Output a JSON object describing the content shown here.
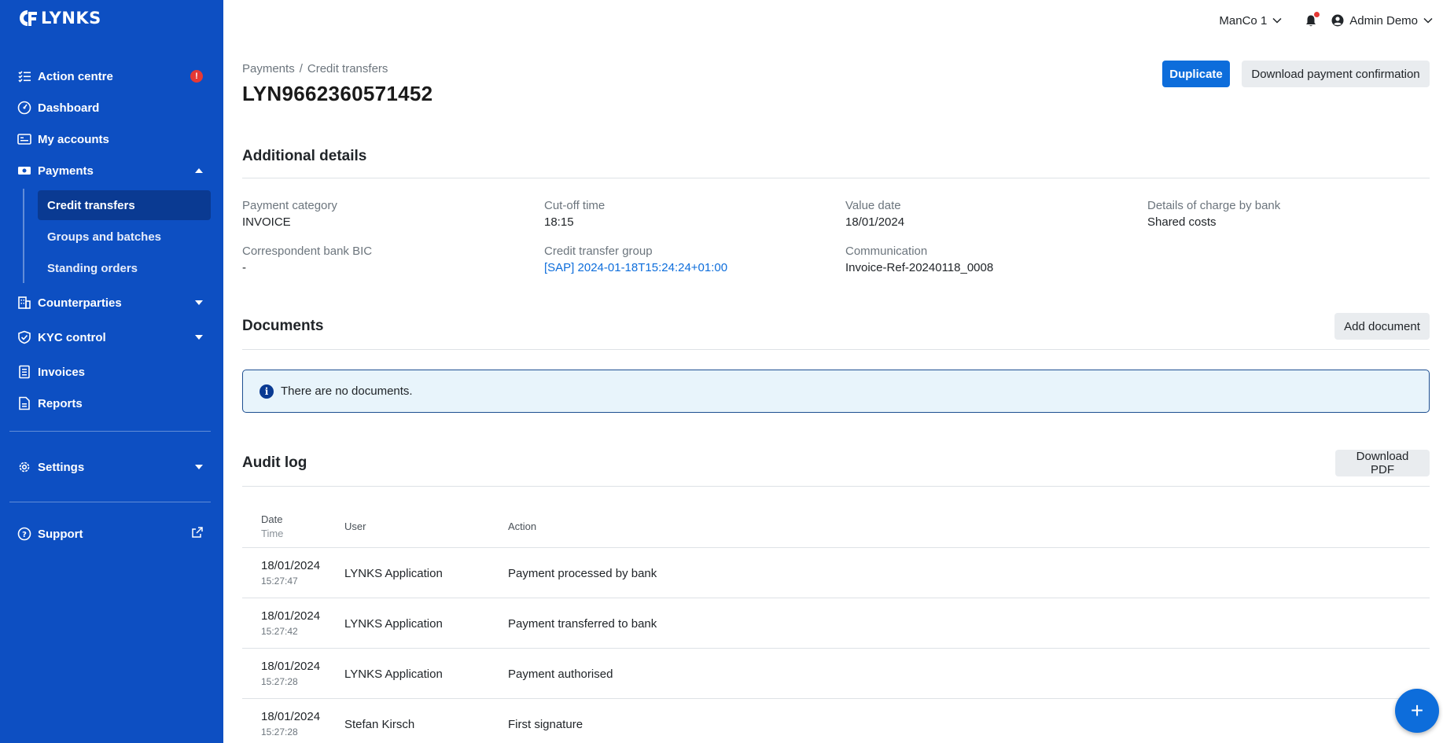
{
  "brand": {
    "name": "LYNKS"
  },
  "colors": {
    "sidebar": "#0d4fc2",
    "primary": "#0d6ddb",
    "alert_bg": "#e8f4fb",
    "badge": "#e53935"
  },
  "sidebar": {
    "items": [
      {
        "label": "Action centre",
        "icon": "list-check-icon",
        "badge": "!"
      },
      {
        "label": "Dashboard",
        "icon": "gauge-icon"
      },
      {
        "label": "My accounts",
        "icon": "accounts-icon"
      },
      {
        "label": "Payments",
        "icon": "payments-icon",
        "expanded": true
      },
      {
        "label": "Counterparties",
        "icon": "building-icon"
      },
      {
        "label": "KYC control",
        "icon": "shield-check-icon"
      },
      {
        "label": "Invoices",
        "icon": "invoice-icon"
      },
      {
        "label": "Reports",
        "icon": "report-icon"
      },
      {
        "label": "Settings",
        "icon": "gear-icon"
      },
      {
        "label": "Support",
        "icon": "help-circle-icon"
      }
    ],
    "payments_sub": [
      {
        "label": "Credit transfers",
        "active": true
      },
      {
        "label": "Groups and batches"
      },
      {
        "label": "Standing orders"
      }
    ]
  },
  "topbar": {
    "company": "ManCo 1",
    "user": "Admin Demo"
  },
  "breadcrumb": {
    "parent": "Payments",
    "separator": "/",
    "current": "Credit transfers"
  },
  "page": {
    "title": "LYN9662360571452",
    "duplicate_label": "Duplicate",
    "download_confirmation_label": "Download payment confirmation"
  },
  "details": {
    "title": "Additional details",
    "payment_category": {
      "label": "Payment category",
      "value": "INVOICE"
    },
    "cutoff_time": {
      "label": "Cut-off time",
      "value": "18:15"
    },
    "value_date": {
      "label": "Value date",
      "value": "18/01/2024"
    },
    "charges": {
      "label": "Details of charge by bank",
      "value": "Shared costs"
    },
    "correspondent_bic": {
      "label": "Correspondent bank BIC",
      "value": "-"
    },
    "transfer_group": {
      "label": "Credit transfer group",
      "value": "[SAP] 2024-01-18T15:24:24+01:00"
    },
    "communication": {
      "label": "Communication",
      "value": "Invoice-Ref-20240118_0008"
    }
  },
  "documents": {
    "title": "Documents",
    "add_label": "Add document",
    "empty_message": "There are no documents."
  },
  "audit": {
    "title": "Audit log",
    "download_label": "Download PDF",
    "headers": {
      "date": "Date",
      "time": "Time",
      "user": "User",
      "action": "Action"
    },
    "rows": [
      {
        "date": "18/01/2024",
        "time": "15:27:47",
        "user": "LYNKS Application",
        "action": "Payment processed by bank"
      },
      {
        "date": "18/01/2024",
        "time": "15:27:42",
        "user": "LYNKS Application",
        "action": "Payment transferred to bank"
      },
      {
        "date": "18/01/2024",
        "time": "15:27:28",
        "user": "LYNKS Application",
        "action": "Payment authorised"
      },
      {
        "date": "18/01/2024",
        "time": "15:27:28",
        "user": "Stefan Kirsch",
        "action": "First signature"
      }
    ]
  },
  "fab": {
    "label": "+"
  }
}
